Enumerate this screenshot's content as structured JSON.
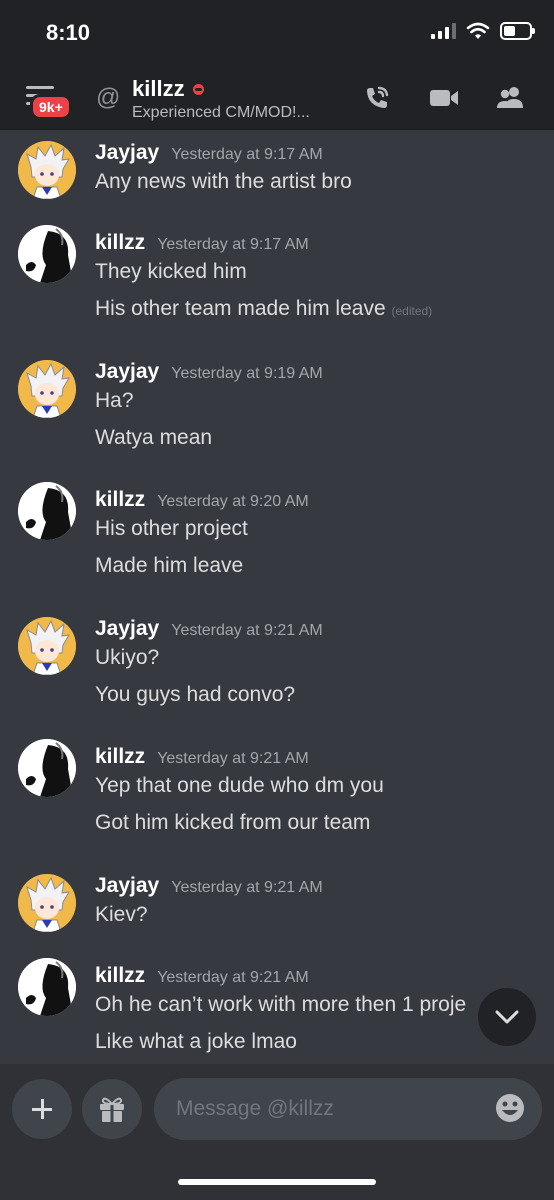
{
  "status_bar": {
    "time": "8:10"
  },
  "header": {
    "notification_badge": "9k+",
    "dm_name": "killzz",
    "dm_subtitle": "Experienced CM/MOD!...",
    "status_color": "#ed4245"
  },
  "messages": [
    {
      "author": "Jayjay",
      "avatar": "jayjay-avatar",
      "timestamp": "Yesterday at 9:17 AM",
      "lines": [
        "Any news with the artist bro"
      ]
    },
    {
      "author": "killzz",
      "avatar": "killzz-avatar",
      "timestamp": "Yesterday at 9:17 AM",
      "lines": [
        "They kicked him",
        "His other team made him leave"
      ],
      "edited_label": "(edited)"
    },
    {
      "author": "Jayjay",
      "avatar": "jayjay-avatar",
      "timestamp": "Yesterday at 9:19 AM",
      "lines": [
        "Ha?",
        "Watya mean"
      ]
    },
    {
      "author": "killzz",
      "avatar": "killzz-avatar",
      "timestamp": "Yesterday at 9:20 AM",
      "lines": [
        "His other project",
        "Made him leave"
      ]
    },
    {
      "author": "Jayjay",
      "avatar": "jayjay-avatar",
      "timestamp": "Yesterday at 9:21 AM",
      "lines": [
        "Ukiyo?",
        "You guys had convo?"
      ]
    },
    {
      "author": "killzz",
      "avatar": "killzz-avatar",
      "timestamp": "Yesterday at 9:21 AM",
      "lines": [
        "Yep that one dude who dm you",
        "Got him kicked from our team"
      ]
    },
    {
      "author": "Jayjay",
      "avatar": "jayjay-avatar",
      "timestamp": "Yesterday at 9:21 AM",
      "lines": [
        "Kiev?"
      ]
    },
    {
      "author": "killzz",
      "avatar": "killzz-avatar",
      "timestamp": "Yesterday at 9:21 AM",
      "lines": [
        "Oh he can’t work with more then 1 proje",
        "Like what a joke lmao"
      ]
    }
  ],
  "composer": {
    "placeholder": "Message @killzz"
  },
  "colors": {
    "background": "#36393f",
    "header": "#202225",
    "composer": "#2f3136",
    "input": "#40444b",
    "badge": "#ed4245"
  }
}
